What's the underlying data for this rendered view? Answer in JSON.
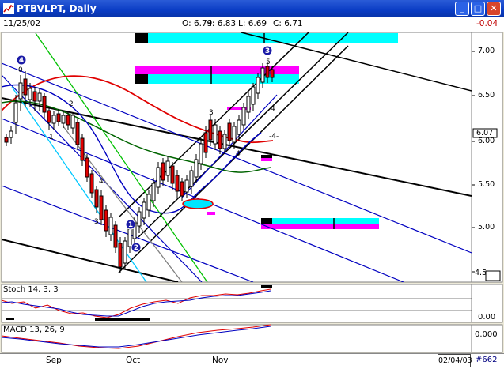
{
  "window": {
    "title": "PTBVLPT, Daily",
    "min_label": "_",
    "max_label": "□",
    "close_label": "✕"
  },
  "infobar": {
    "date": "11/25/02",
    "open": "O: 6.79",
    "high": "H: 6.83",
    "low": "L: 6.69",
    "close": "C: 6.71",
    "change": "-0.04"
  },
  "price_axis": [
    "7.00",
    "6.50",
    "6.07",
    "6.00",
    "5.50",
    "5.00",
    "4.5"
  ],
  "wave_labels": [
    "4",
    "0",
    "2",
    "1",
    "3",
    "4",
    "5",
    "1",
    "2",
    "3",
    "4",
    "5",
    "3",
    "-4-"
  ],
  "stoch": {
    "label": "Stoch 14, 3, 3",
    "axis_value": "0.00"
  },
  "macd": {
    "label": "MACD 13, 26, 9",
    "axis_value": "0.000"
  },
  "footer": {
    "months": [
      "Sep",
      "Oct",
      "Nov"
    ],
    "end_date": "02/04/03",
    "count": "#662"
  },
  "colors": {
    "titlebar": "#0a3cc4",
    "up_candle": "#ffffff",
    "down_candle": "#e00000",
    "ma_red": "#e00000",
    "ma_green": "#008000",
    "channel_blue": "#0000c0",
    "zone_cyan": "#00ffff",
    "zone_magenta": "#ff00ff"
  }
}
